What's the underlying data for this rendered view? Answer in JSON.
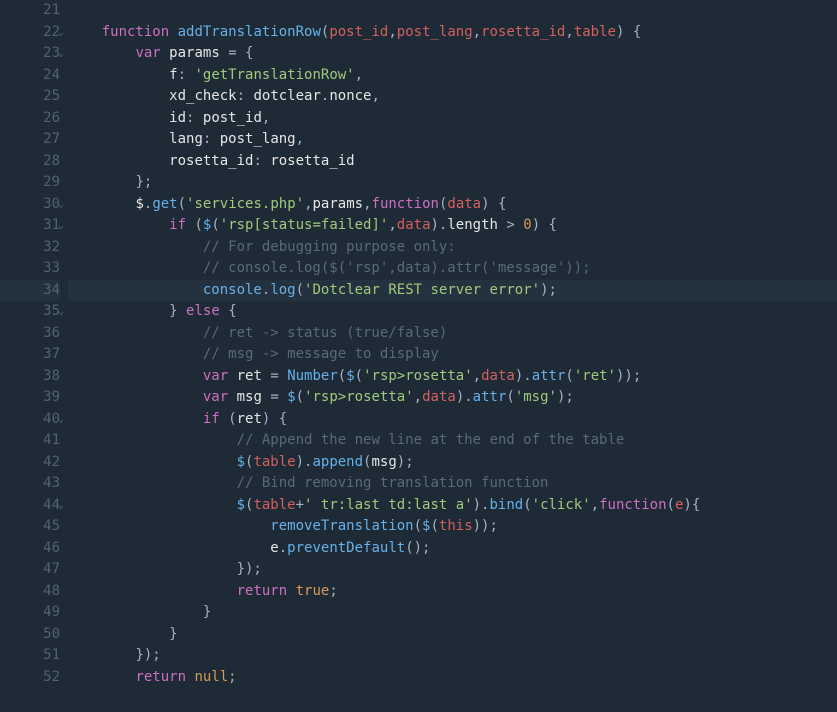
{
  "lines": [
    {
      "num": 21,
      "fold": "",
      "diff": false,
      "html": ""
    },
    {
      "num": 22,
      "fold": "v",
      "diff": false,
      "html": "    <span class='kw'>function</span> <span class='fn'>addTranslationRow</span><span class='op'>(</span><span class='pr'>post_id</span><span class='op'>,</span><span class='pr'>post_lang</span><span class='op'>,</span><span class='pr'>rosetta_id</span><span class='op'>,</span><span class='pr'>table</span><span class='op'>) {</span>"
    },
    {
      "num": 23,
      "fold": "v",
      "diff": false,
      "html": "        <span class='kw'>var</span> <span class='vr'>params</span> <span class='op'>= {</span>"
    },
    {
      "num": 24,
      "fold": "",
      "diff": false,
      "html": "            <span class='vr'>f</span><span class='op'>:</span> <span class='st'>'getTranslationRow'</span><span class='op'>,</span>"
    },
    {
      "num": 25,
      "fold": "",
      "diff": false,
      "html": "            <span class='vr'>xd_check</span><span class='op'>:</span> <span class='vr'>dotclear</span><span class='op'>.</span><span class='vr'>nonce</span><span class='op'>,</span>"
    },
    {
      "num": 26,
      "fold": "",
      "diff": false,
      "html": "            <span class='vr'>id</span><span class='op'>:</span> <span class='vr'>post_id</span><span class='op'>,</span>"
    },
    {
      "num": 27,
      "fold": "",
      "diff": false,
      "html": "            <span class='vr'>lang</span><span class='op'>:</span> <span class='vr'>post_lang</span><span class='op'>,</span>"
    },
    {
      "num": 28,
      "fold": "",
      "diff": false,
      "html": "            <span class='vr'>rosetta_id</span><span class='op'>:</span> <span class='vr'>rosetta_id</span>"
    },
    {
      "num": 29,
      "fold": "",
      "diff": false,
      "html": "        <span class='op'>};</span>"
    },
    {
      "num": 30,
      "fold": "v",
      "diff": false,
      "html": "        <span class='vr'>$</span><span class='op'>.</span><span class='fn'>get</span><span class='op'>(</span><span class='st'>'services.php'</span><span class='op'>,</span><span class='vr'>params</span><span class='op'>,</span><span class='kw'>function</span><span class='op'>(</span><span class='pr'>data</span><span class='op'>) {</span>"
    },
    {
      "num": 31,
      "fold": "v",
      "diff": false,
      "html": "            <span class='kw'>if</span> <span class='op'>(</span><span class='fn'>$</span><span class='op'>(</span><span class='st'>'rsp[status=failed]'</span><span class='op'>,</span><span class='pr'>data</span><span class='op'>).</span><span class='vr'>length</span> <span class='op'>&gt;</span> <span class='nm'>0</span><span class='op'>) {</span>"
    },
    {
      "num": 32,
      "fold": "",
      "diff": false,
      "html": "                <span class='cm'>// For debugging purpose only:</span>"
    },
    {
      "num": 33,
      "fold": "",
      "diff": false,
      "html": "                <span class='cm'>// console.log($('rsp',data).attr('message'));</span>"
    },
    {
      "num": 34,
      "fold": "",
      "diff": true,
      "html": "                <span class='bl'>console</span><span class='op'>.</span><span class='fn'>log</span><span class='op'>(</span><span class='st'>'Dotclear REST server error'</span><span class='op'>);</span>"
    },
    {
      "num": 35,
      "fold": "v",
      "diff": false,
      "html": "            <span class='op'>}</span> <span class='kw'>else</span> <span class='op'>{</span>"
    },
    {
      "num": 36,
      "fold": "",
      "diff": false,
      "html": "                <span class='cm'>// ret -&gt; status (true/false)</span>"
    },
    {
      "num": 37,
      "fold": "",
      "diff": false,
      "html": "                <span class='cm'>// msg -&gt; message to display</span>"
    },
    {
      "num": 38,
      "fold": "",
      "diff": false,
      "html": "                <span class='kw'>var</span> <span class='vr'>ret</span> <span class='op'>=</span> <span class='fn'>Number</span><span class='op'>(</span><span class='fn'>$</span><span class='op'>(</span><span class='st'>'rsp&gt;rosetta'</span><span class='op'>,</span><span class='pr'>data</span><span class='op'>).</span><span class='fn'>attr</span><span class='op'>(</span><span class='st'>'ret'</span><span class='op'>));</span>"
    },
    {
      "num": 39,
      "fold": "",
      "diff": false,
      "html": "                <span class='kw'>var</span> <span class='vr'>msg</span> <span class='op'>=</span> <span class='fn'>$</span><span class='op'>(</span><span class='st'>'rsp&gt;rosetta'</span><span class='op'>,</span><span class='pr'>data</span><span class='op'>).</span><span class='fn'>attr</span><span class='op'>(</span><span class='st'>'msg'</span><span class='op'>);</span>"
    },
    {
      "num": 40,
      "fold": "v",
      "diff": false,
      "html": "                <span class='kw'>if</span> <span class='op'>(</span><span class='vr'>ret</span><span class='op'>) {</span>"
    },
    {
      "num": 41,
      "fold": "",
      "diff": false,
      "html": "                    <span class='cm'>// Append the new line at the end of the table</span>"
    },
    {
      "num": 42,
      "fold": "",
      "diff": false,
      "html": "                    <span class='fn'>$</span><span class='op'>(</span><span class='pr'>table</span><span class='op'>).</span><span class='fn'>append</span><span class='op'>(</span><span class='vr'>msg</span><span class='op'>);</span>"
    },
    {
      "num": 43,
      "fold": "",
      "diff": false,
      "html": "                    <span class='cm'>// Bind removing translation function</span>"
    },
    {
      "num": 44,
      "fold": "v",
      "diff": false,
      "html": "                    <span class='fn'>$</span><span class='op'>(</span><span class='pr'>table</span><span class='op'>+</span><span class='st'>' tr:last td:last a'</span><span class='op'>).</span><span class='fn'>bind</span><span class='op'>(</span><span class='st'>'click'</span><span class='op'>,</span><span class='kw'>function</span><span class='op'>(</span><span class='pr'>e</span><span class='op'>){</span>"
    },
    {
      "num": 45,
      "fold": "",
      "diff": false,
      "html": "                        <span class='fn'>removeTranslation</span><span class='op'>(</span><span class='fn'>$</span><span class='op'>(</span><span class='c2'>this</span><span class='op'>));</span>"
    },
    {
      "num": 46,
      "fold": "",
      "diff": false,
      "html": "                        <span class='vr'>e</span><span class='op'>.</span><span class='fn'>preventDefault</span><span class='op'>();</span>"
    },
    {
      "num": 47,
      "fold": "",
      "diff": false,
      "html": "                    <span class='op'>});</span>"
    },
    {
      "num": 48,
      "fold": "",
      "diff": false,
      "html": "                    <span class='kw'>return</span> <span class='nm'>true</span><span class='op'>;</span>"
    },
    {
      "num": 49,
      "fold": "",
      "diff": false,
      "html": "                <span class='op'>}</span>"
    },
    {
      "num": 50,
      "fold": "",
      "diff": false,
      "html": "            <span class='op'>}</span>"
    },
    {
      "num": 51,
      "fold": "",
      "diff": false,
      "html": "        <span class='op'>});</span>"
    },
    {
      "num": 52,
      "fold": "",
      "diff": false,
      "html": "        <span class='kw'>return</span> <span class='nm'>null</span><span class='op'>;</span>"
    }
  ],
  "highlight_line": 34,
  "fold_glyph": "⌄",
  "diff_glyph": "‹›"
}
